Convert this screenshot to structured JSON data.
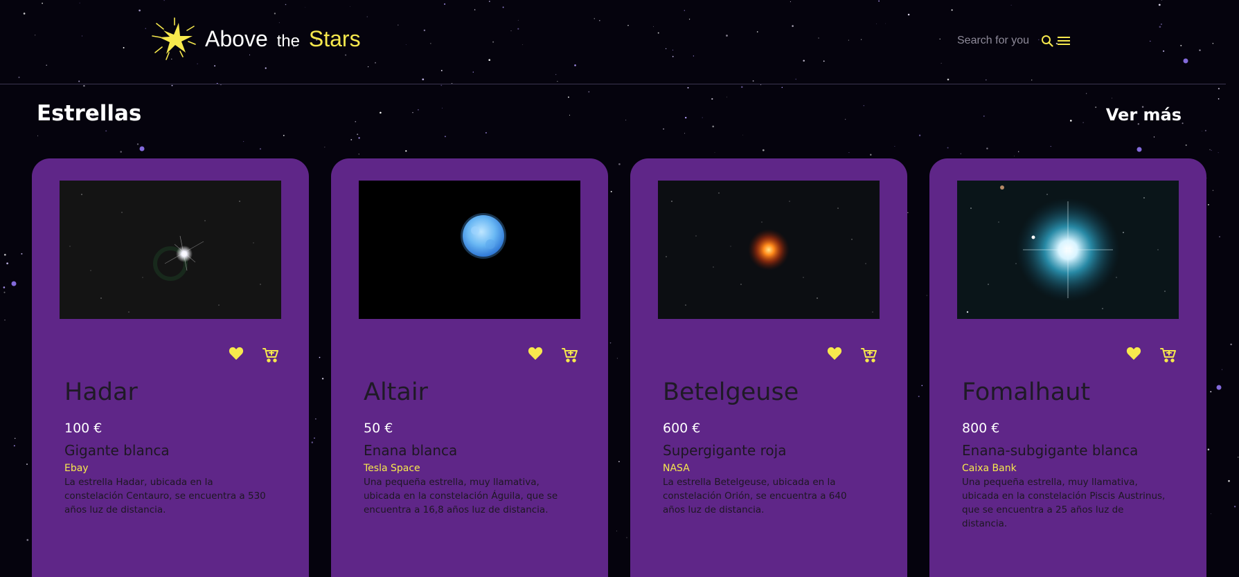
{
  "colors": {
    "background": "#05030d",
    "card": "#5f2688",
    "accent_yellow": "#f7e94d",
    "white": "#ffffff",
    "dark_text": "#1d1722"
  },
  "header": {
    "brand": {
      "word1": "Above",
      "word2": "the",
      "word3": "Stars"
    },
    "logo_icon": "star-burst-icon",
    "search": {
      "placeholder": "Search for you"
    },
    "search_icon": "search-icon",
    "menu_icon": "hamburger-menu-icon"
  },
  "section": {
    "title": "Estrellas",
    "more_label": "Ver más"
  },
  "cards": [
    {
      "name": "Hadar",
      "price": "100 €",
      "type": "Gigante blanca",
      "seller": "Ebay",
      "description": "La estrella Hadar, ubicada en la constelación Centauro, se encuentra a 530 años luz de distancia.",
      "image": "white-star-photo"
    },
    {
      "name": "Altair",
      "price": "50 €",
      "type": "Enana blanca",
      "seller": "Tesla Space",
      "description": "Una pequeña estrella, muy llamativa, ubicada en la constelación Águila, que se encuentra a 16,8 años luz de distancia.",
      "image": "blue-star-disc-photo"
    },
    {
      "name": "Betelgeuse",
      "price": "600 €",
      "type": "Supergigante roja",
      "seller": "NASA",
      "description": "La estrella Betelgeuse, ubicada en la constelación Orión, se encuentra a 640 años luz de distancia.",
      "image": "red-star-photo"
    },
    {
      "name": "Fomalhaut",
      "price": "800 €",
      "type": "Enana-subgigante blanca",
      "seller": "Caixa Bank",
      "description": "Una pequeña estrella, muy llamativa, ubicada en la constelación Piscis Austrinus, que se encuentra a 25 años luz de distancia.",
      "image": "blue-white-star-photo"
    }
  ],
  "card_icons": {
    "favorite": "heart-icon",
    "cart": "add-to-cart-icon"
  }
}
